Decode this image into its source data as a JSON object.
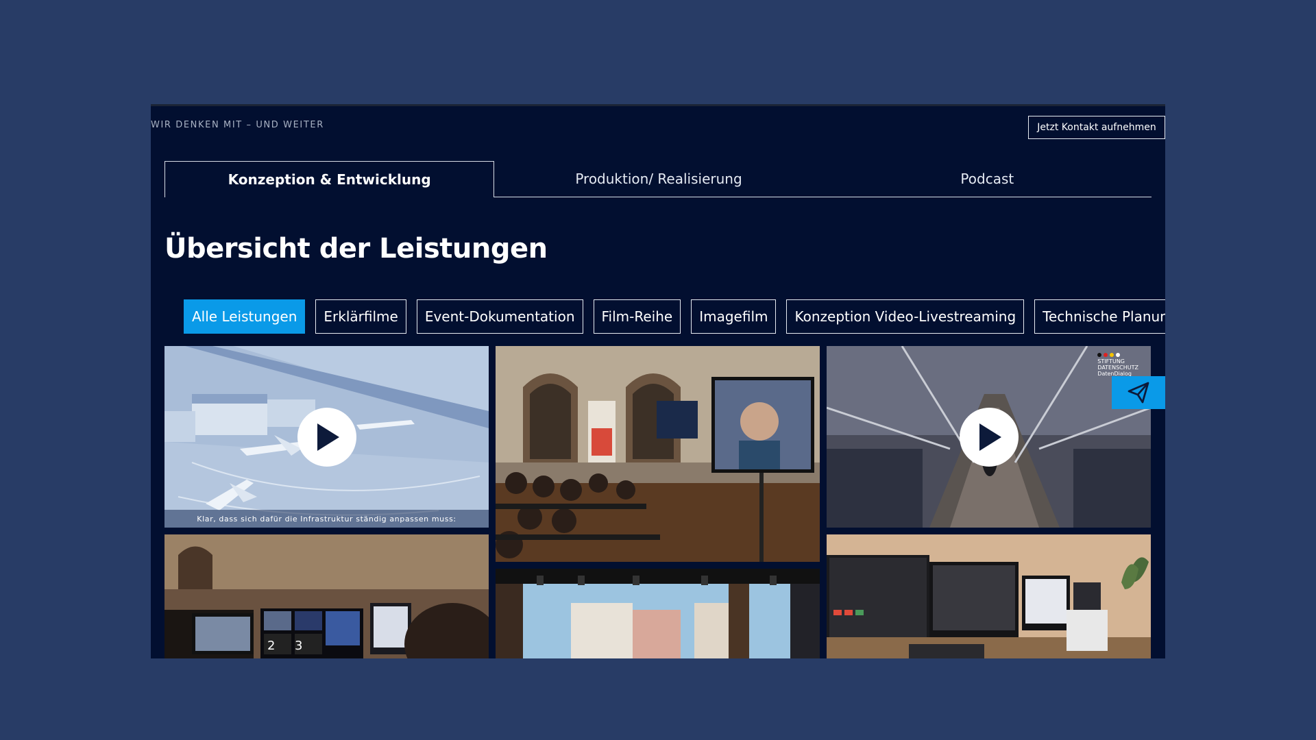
{
  "header": {
    "tagline": "WIR DENKEN MIT – UND WEITER",
    "contact_label": "Jetzt Kontakt aufnehmen"
  },
  "tabs": [
    {
      "label": "Konzeption & Entwicklung",
      "active": true
    },
    {
      "label": "Produktion/ Realisierung",
      "active": false
    },
    {
      "label": "Podcast",
      "active": false
    }
  ],
  "main": {
    "title": "Übersicht der Leistungen"
  },
  "filters": [
    {
      "label": "Alle Leistungen",
      "active": true
    },
    {
      "label": "Erklärfilme",
      "active": false
    },
    {
      "label": "Event-Dokumentation",
      "active": false
    },
    {
      "label": "Film-Reihe",
      "active": false
    },
    {
      "label": "Imagefilm",
      "active": false
    },
    {
      "label": "Konzeption Video-Livestreaming",
      "active": false
    },
    {
      "label": "Technische Planung",
      "active": false
    }
  ],
  "tiles": {
    "airport": {
      "caption": "Klar, dass sich dafür die Infrastruktur ständig anpassen muss:"
    },
    "bridge": {
      "logo_line1": "STIFTUNG",
      "logo_line2": "DATENSCHUTZ",
      "logo_line3": "DatenDialog"
    },
    "control_room": {
      "monitor_1": "2",
      "monitor_2": "3"
    }
  },
  "icons": {
    "play": "play-icon",
    "send": "paper-plane-icon"
  },
  "colors": {
    "page_bg": "#283c66",
    "panel_bg": "#020f30",
    "accent": "#0a9ae8"
  }
}
